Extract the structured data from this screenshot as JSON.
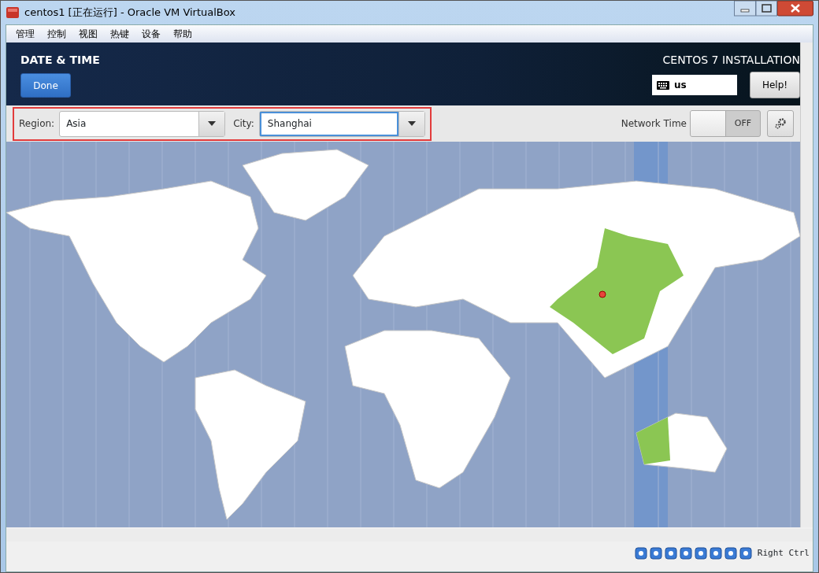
{
  "window": {
    "title": "centos1 [正在运行] - Oracle VM VirtualBox"
  },
  "menu": [
    "管理",
    "控制",
    "视图",
    "热键",
    "设备",
    "帮助"
  ],
  "header": {
    "title": "DATE & TIME",
    "done_button": "Done",
    "product": "CENTOS 7 INSTALLATION",
    "keyboard": "us",
    "help_button": "Help!"
  },
  "toolbar": {
    "region_label": "Region:",
    "region_value": "Asia",
    "city_label": "City:",
    "city_value": "Shanghai",
    "network_time_label": "Network Time",
    "network_time": {
      "on": false,
      "label": "OFF"
    }
  },
  "status_bar": {
    "host_key": "Right Ctrl"
  }
}
